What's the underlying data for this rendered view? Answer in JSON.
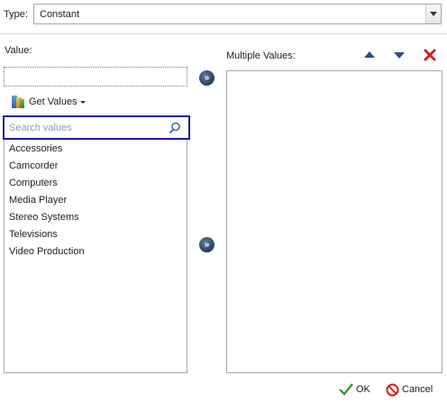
{
  "type_row": {
    "label": "Type:",
    "selected": "Constant"
  },
  "value": {
    "label": "Value:",
    "input_value": ""
  },
  "get_values": {
    "label": "Get Values",
    "icon": "bar-chart-icon"
  },
  "search": {
    "placeholder": "Search values",
    "icon": "search-icon"
  },
  "values_list": [
    "Accessories",
    "Camcorder",
    "Computers",
    "Media Player",
    "Stereo Systems",
    "Televisions",
    "Video Production"
  ],
  "multiple_values": {
    "label": "Multiple Values:",
    "items": []
  },
  "buttons": {
    "ok": "OK",
    "cancel": "Cancel",
    "move_right": "»"
  },
  "colors": {
    "search_focus_border": "#1a1aa8",
    "arrow_button": "#2c4e8c",
    "delete_red": "#d42020",
    "ok_green": "#3a9a2a"
  }
}
